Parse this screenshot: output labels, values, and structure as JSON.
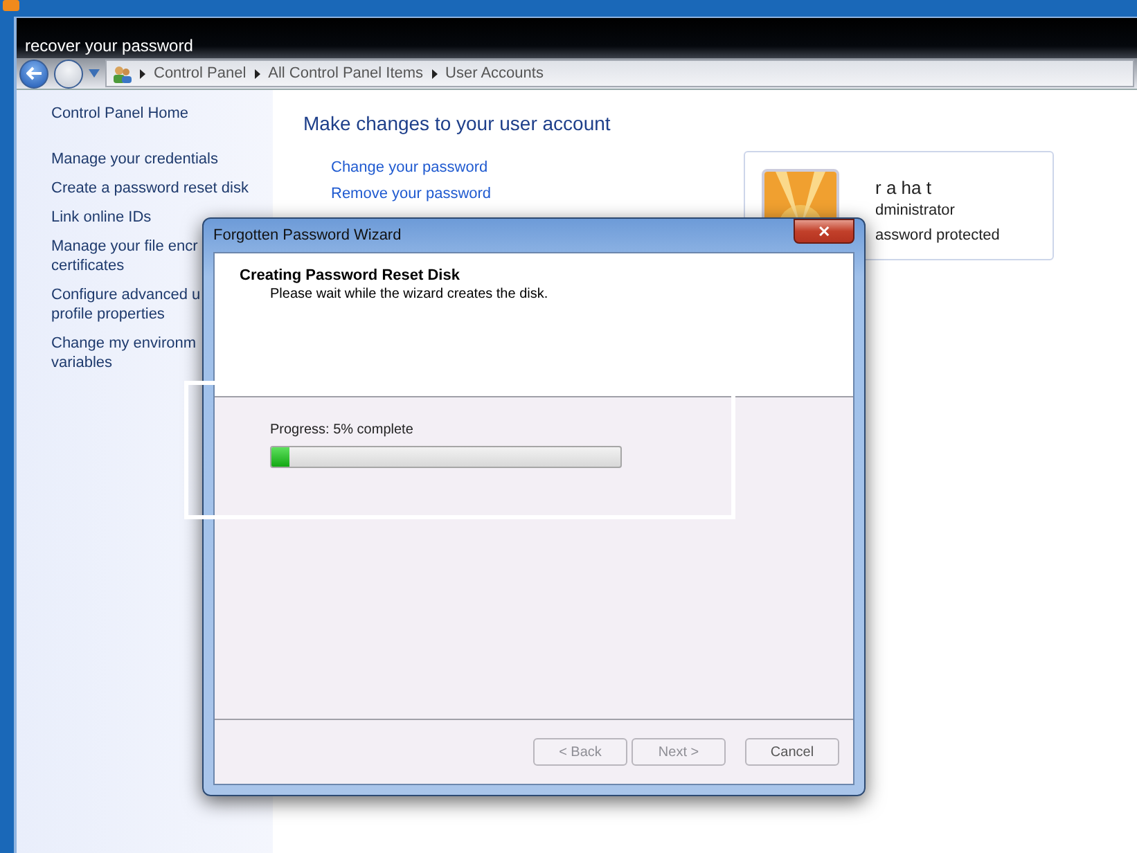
{
  "window": {
    "title": "recover your password"
  },
  "breadcrumb": [
    "Control Panel",
    "All Control Panel Items",
    "User Accounts"
  ],
  "sidebar": {
    "home": "Control Panel Home",
    "items": [
      {
        "label": "Manage your credentials"
      },
      {
        "label": "Create a password reset disk"
      },
      {
        "label": "Link online IDs"
      },
      {
        "label": "Manage your file encr",
        "label_2": "certificates"
      },
      {
        "label": "Configure advanced u",
        "label_2": "profile properties"
      },
      {
        "label": "Change my environm",
        "label_2": "variables"
      }
    ]
  },
  "main": {
    "heading": "Make changes to your user account",
    "links": [
      "Change your password",
      "Remove your password"
    ]
  },
  "user_card": {
    "name": "r a ha t",
    "role": "dministrator",
    "status": "assword protected"
  },
  "dialog": {
    "title": "Forgotten Password Wizard",
    "close": "✕",
    "heading": "Creating Password Reset Disk",
    "subheading": "Please wait while the wizard creates the disk.",
    "progress": {
      "label": "Progress: 5% complete",
      "level": 0.05
    },
    "buttons": [
      {
        "label": "< Back",
        "disabled": true
      },
      {
        "label": "Next >",
        "disabled": true
      },
      {
        "label": "Cancel",
        "disabled": false
      }
    ]
  }
}
